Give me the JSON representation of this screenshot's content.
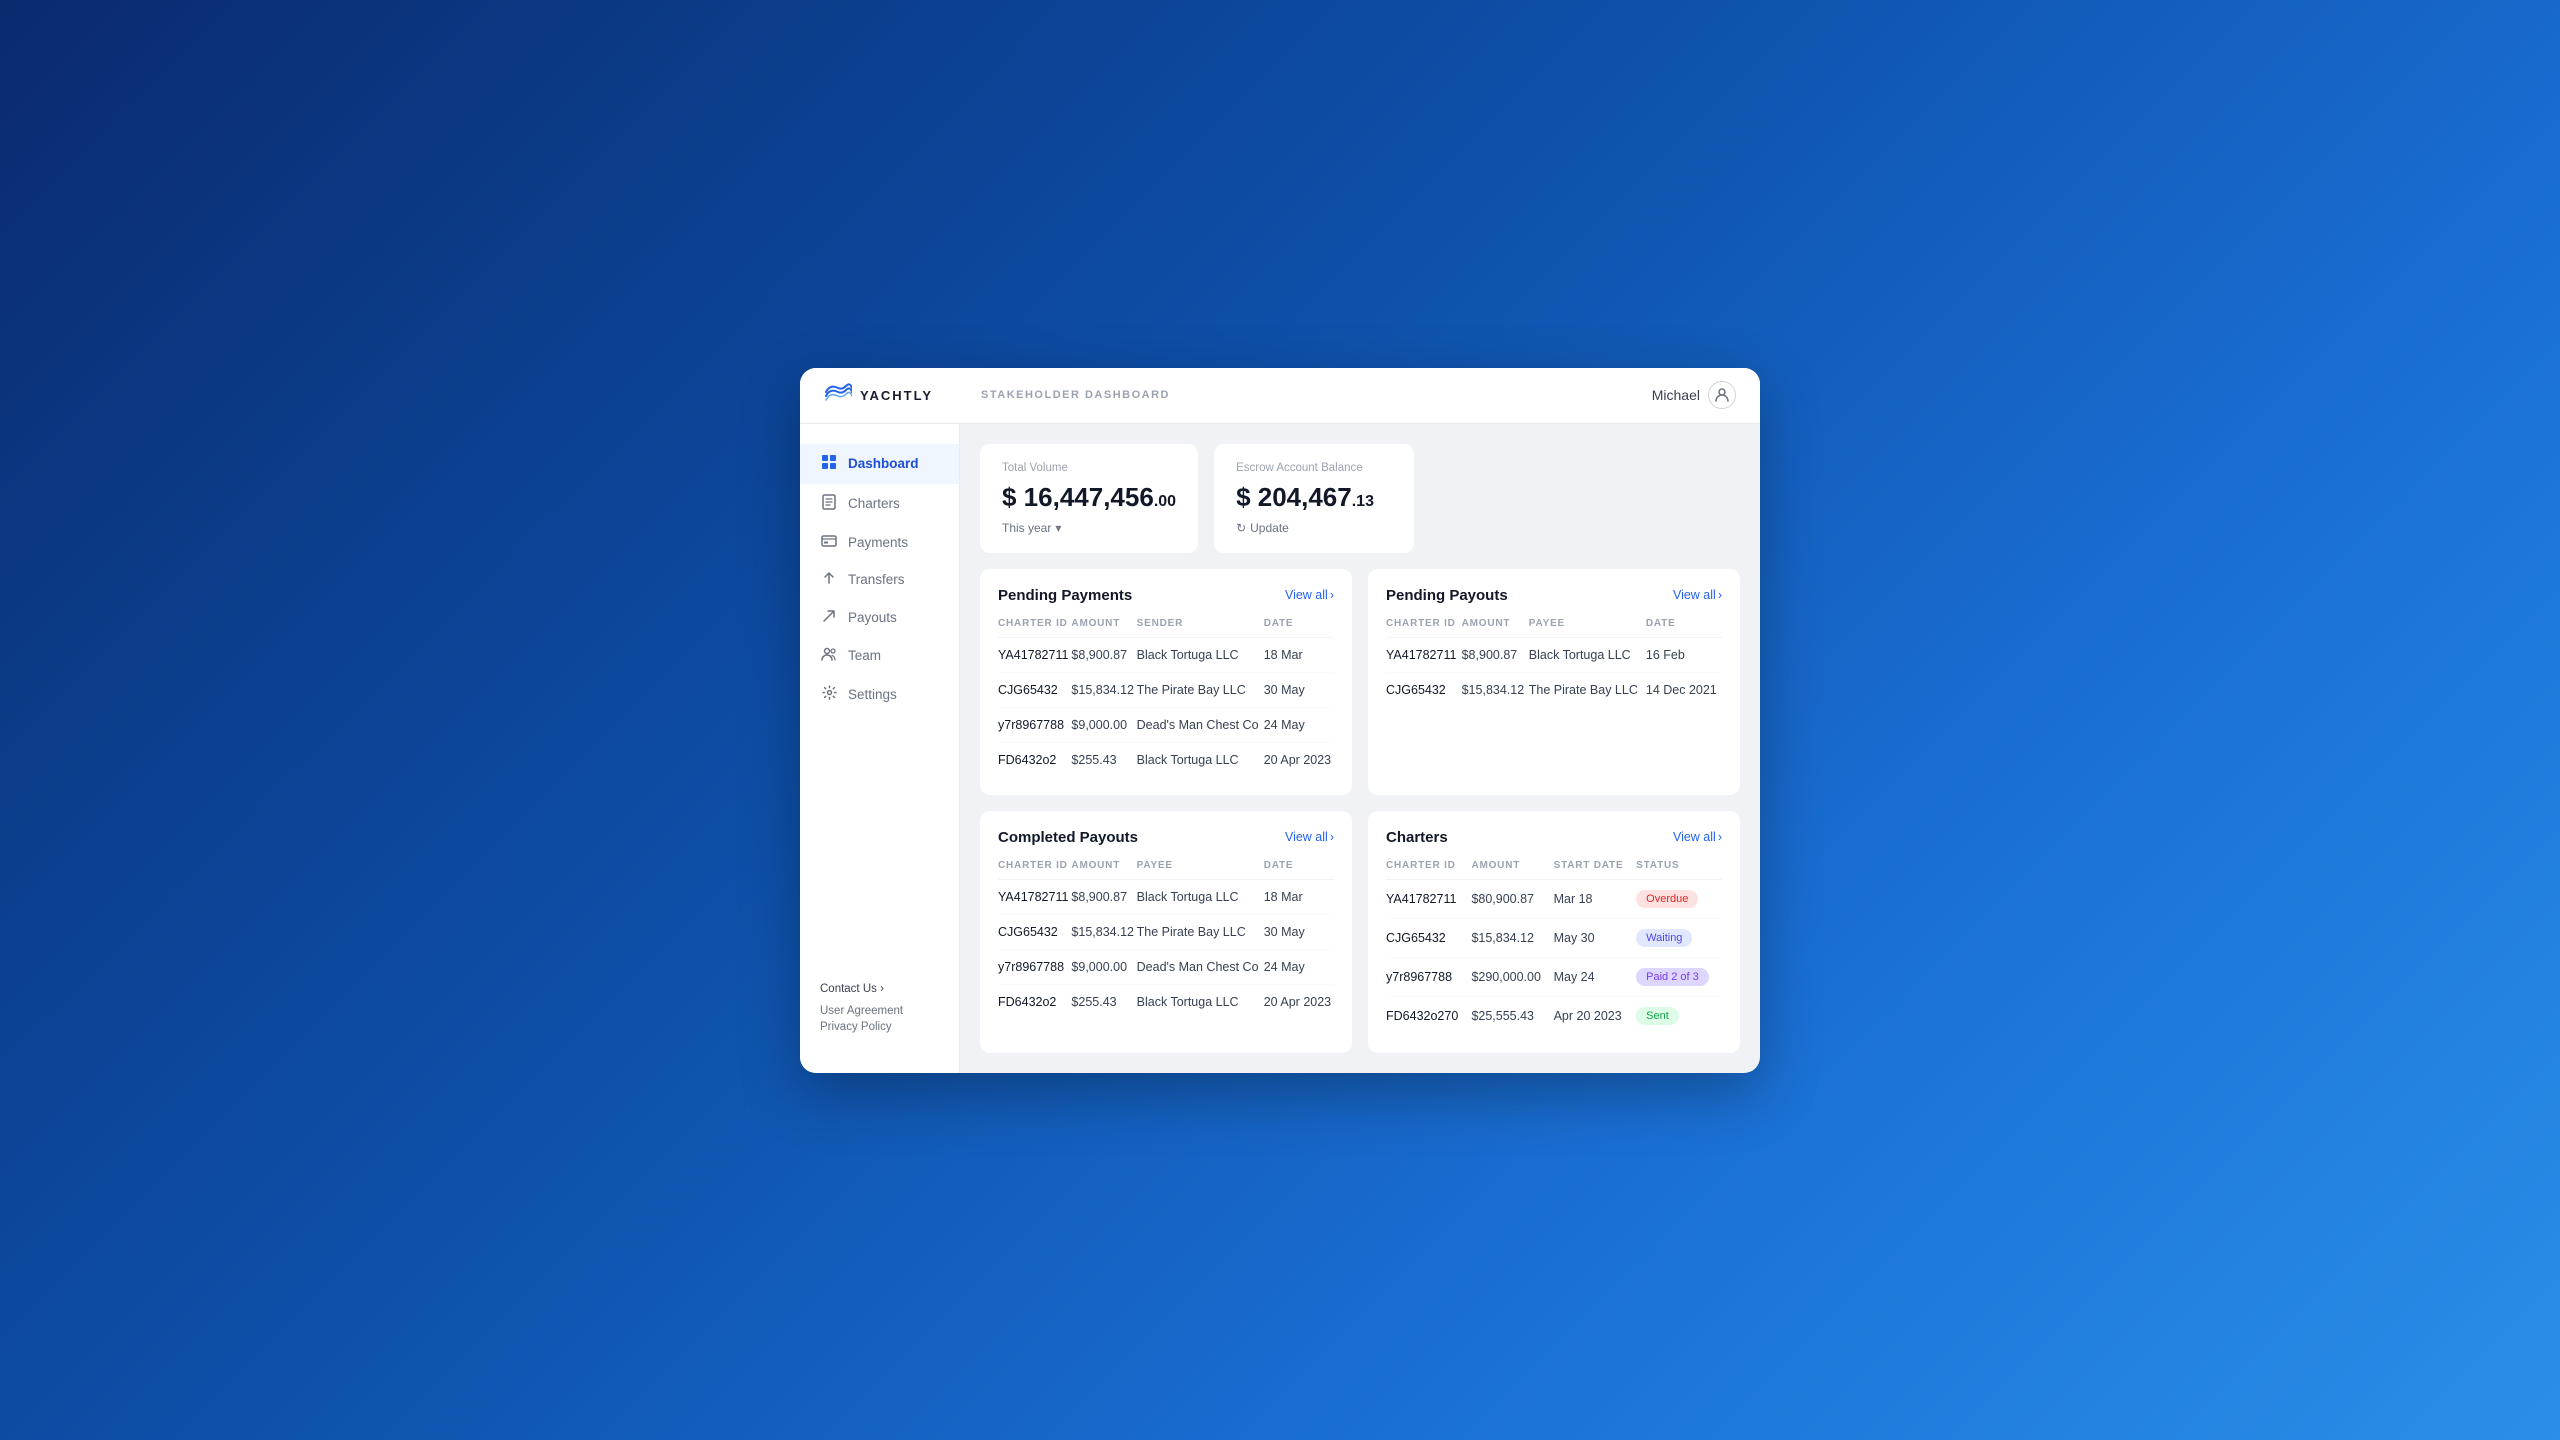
{
  "header": {
    "logo_text": "YACHTLY",
    "page_title": "STAKEHOLDER DASHBOARD",
    "user_name": "Michael"
  },
  "sidebar": {
    "nav_items": [
      {
        "id": "dashboard",
        "label": "Dashboard",
        "icon": "⊞",
        "active": true
      },
      {
        "id": "charters",
        "label": "Charters",
        "icon": "📄",
        "active": false
      },
      {
        "id": "payments",
        "label": "Payments",
        "icon": "💳",
        "active": false
      },
      {
        "id": "transfers",
        "label": "Transfers",
        "icon": "↑",
        "active": false
      },
      {
        "id": "payouts",
        "label": "Payouts",
        "icon": "↗",
        "active": false
      },
      {
        "id": "team",
        "label": "Team",
        "icon": "👤",
        "active": false
      },
      {
        "id": "settings",
        "label": "Settings",
        "icon": "⚙",
        "active": false
      }
    ],
    "contact_label": "Contact Us",
    "user_agreement": "User Agreement",
    "privacy_policy": "Privacy Policy"
  },
  "stats": {
    "total_volume": {
      "label": "Total Volume",
      "value": "$ 16,447,456",
      "cents": ".00",
      "period": "This year"
    },
    "escrow_balance": {
      "label": "Escrow Account Balance",
      "value": "$ 204,467",
      "cents": ".13",
      "update_label": "Update"
    }
  },
  "pending_payments": {
    "title": "Pending Payments",
    "view_all": "View all",
    "columns": [
      "CHARTER ID",
      "AMOUNT",
      "SENDER",
      "DATE"
    ],
    "rows": [
      {
        "charter_id": "YA41782711",
        "amount": "$8,900.87",
        "sender": "Black Tortuga LLC",
        "date": "18 Mar"
      },
      {
        "charter_id": "CJG65432",
        "amount": "$15,834.12",
        "sender": "The Pirate Bay LLC",
        "date": "30 May"
      },
      {
        "charter_id": "y7r8967788",
        "amount": "$9,000.00",
        "sender": "Dead's Man Chest Co",
        "date": "24 May"
      },
      {
        "charter_id": "FD6432o2",
        "amount": "$255.43",
        "sender": "Black Tortuga LLC",
        "date": "20 Apr 2023"
      }
    ]
  },
  "pending_payouts": {
    "title": "Pending Payouts",
    "view_all": "View all",
    "columns": [
      "CHARTER ID",
      "AMOUNT",
      "PAYEE",
      "DATE"
    ],
    "rows": [
      {
        "charter_id": "YA41782711",
        "amount": "$8,900.87",
        "payee": "Black Tortuga LLC",
        "date": "16 Feb"
      },
      {
        "charter_id": "CJG65432",
        "amount": "$15,834.12",
        "payee": "The Pirate Bay LLC",
        "date": "14 Dec 2021"
      }
    ]
  },
  "completed_payouts": {
    "title": "Completed Payouts",
    "view_all": "View all",
    "columns": [
      "CHARTER ID",
      "AMOUNT",
      "PAYEE",
      "DATE"
    ],
    "rows": [
      {
        "charter_id": "YA41782711",
        "amount": "$8,900.87",
        "payee": "Black Tortuga LLC",
        "date": "18 Mar"
      },
      {
        "charter_id": "CJG65432",
        "amount": "$15,834.12",
        "payee": "The Pirate Bay LLC",
        "date": "30 May"
      },
      {
        "charter_id": "y7r8967788",
        "amount": "$9,000.00",
        "payee": "Dead's Man Chest Co",
        "date": "24 May"
      },
      {
        "charter_id": "FD6432o2",
        "amount": "$255.43",
        "payee": "Black Tortuga LLC",
        "date": "20 Apr 2023"
      }
    ]
  },
  "charters": {
    "title": "Charters",
    "view_all": "View all",
    "columns": [
      "CHARTER ID",
      "AMOUNT",
      "START DATE",
      "STATUS"
    ],
    "rows": [
      {
        "charter_id": "YA41782711",
        "amount": "$80,900.87",
        "start_date": "Mar 18",
        "status": "Overdue",
        "status_type": "overdue"
      },
      {
        "charter_id": "CJG65432",
        "amount": "$15,834.12",
        "start_date": "May 30",
        "status": "Waiting",
        "status_type": "waiting"
      },
      {
        "charter_id": "y7r8967788",
        "amount": "$290,000.00",
        "start_date": "May 24",
        "status": "Paid 2 of 3",
        "status_type": "paid"
      },
      {
        "charter_id": "FD6432o270",
        "amount": "$25,555.43",
        "start_date": "Apr 20 2023",
        "status": "Sent",
        "status_type": "sent"
      }
    ]
  }
}
